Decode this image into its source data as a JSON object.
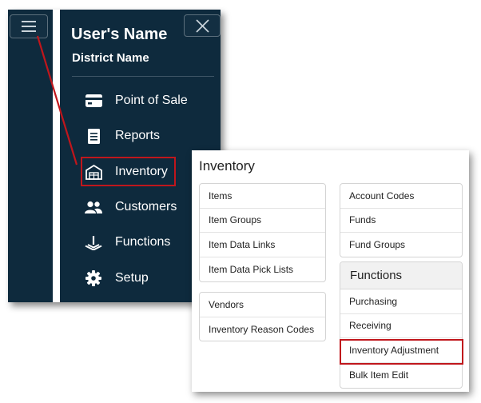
{
  "nav": {
    "user_name": "User's Name",
    "district_name": "District Name",
    "items": [
      {
        "label": "Point of Sale",
        "icon": "credit-card-icon"
      },
      {
        "label": "Reports",
        "icon": "document-icon"
      },
      {
        "label": "Inventory",
        "icon": "warehouse-icon"
      },
      {
        "label": "Customers",
        "icon": "people-icon"
      },
      {
        "label": "Functions",
        "icon": "joystick-icon"
      },
      {
        "label": "Setup",
        "icon": "gear-icon"
      }
    ],
    "highlighted_item": "Inventory"
  },
  "inventory": {
    "title": "Inventory",
    "left_group_1": [
      "Items",
      "Item Groups",
      "Item Data Links",
      "Item Data Pick Lists"
    ],
    "left_group_2": [
      "Vendors",
      "Inventory Reason Codes"
    ],
    "right_group_1": [
      "Account Codes",
      "Funds",
      "Fund Groups"
    ],
    "functions_header": "Functions",
    "functions_items": [
      "Purchasing",
      "Receiving",
      "Inventory Adjustment",
      "Bulk Item Edit"
    ],
    "highlighted_item": "Inventory Adjustment"
  },
  "colors": {
    "nav_background": "#0e2a3d",
    "highlight": "#c0161c"
  }
}
